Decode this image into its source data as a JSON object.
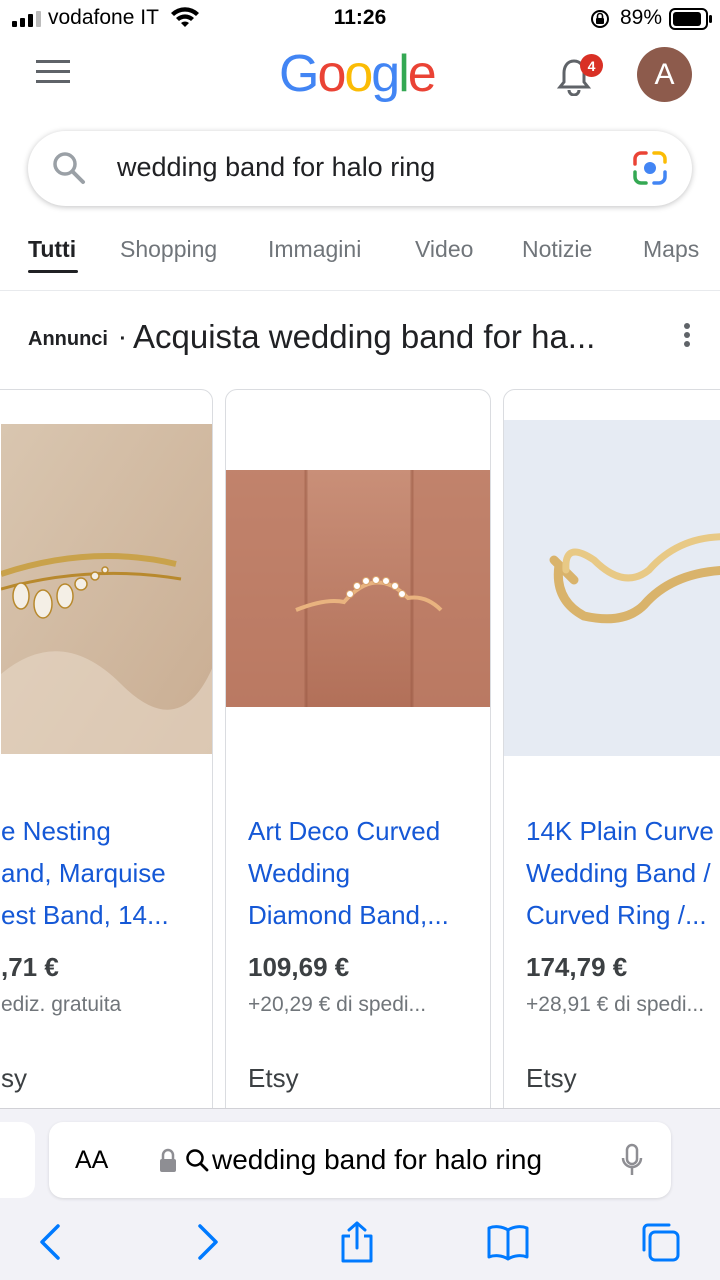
{
  "status_bar": {
    "carrier": "vodafone IT",
    "time": "11:26",
    "battery": "89%"
  },
  "header": {
    "logo_letters": [
      "G",
      "o",
      "o",
      "g",
      "l",
      "e"
    ],
    "logo_colors": [
      "#4285F4",
      "#EA4335",
      "#FBBC05",
      "#4285F4",
      "#34A853",
      "#EA4335"
    ],
    "notifications_count": "4",
    "avatar_initial": "A"
  },
  "search": {
    "query": "wedding band for halo ring"
  },
  "tabs": [
    {
      "label": "Tutti"
    },
    {
      "label": "Shopping"
    },
    {
      "label": "Immagini"
    },
    {
      "label": "Video"
    },
    {
      "label": "Notizie"
    },
    {
      "label": "Maps"
    }
  ],
  "ads": {
    "label": "Annunci",
    "separator": "·",
    "title": "Acquista wedding band for ha..."
  },
  "products": [
    {
      "title_lines": [
        "e Nesting",
        "and, Marquise",
        "est Band, 14..."
      ],
      "price": ",71 €",
      "shipping": "ediz. gratuita",
      "store": "sy"
    },
    {
      "title_lines": [
        "Art Deco Curved",
        "Wedding",
        "Diamond Band,..."
      ],
      "price": "109,69 €",
      "shipping": "+20,29 € di spedi...",
      "store": "Etsy"
    },
    {
      "title_lines": [
        "14K Plain Curve",
        "Wedding Band /",
        "Curved Ring /..."
      ],
      "price": "174,79 €",
      "shipping": "+28,91 € di spedi...",
      "store": "Etsy"
    }
  ],
  "browser": {
    "aa_label": "AA",
    "url_text": "wedding band for halo ring"
  },
  "colors": {
    "link": "#1558d6",
    "accent_badge": "#d93025",
    "avatar_bg": "#8d5b4c",
    "ios_blue": "#007aff"
  }
}
